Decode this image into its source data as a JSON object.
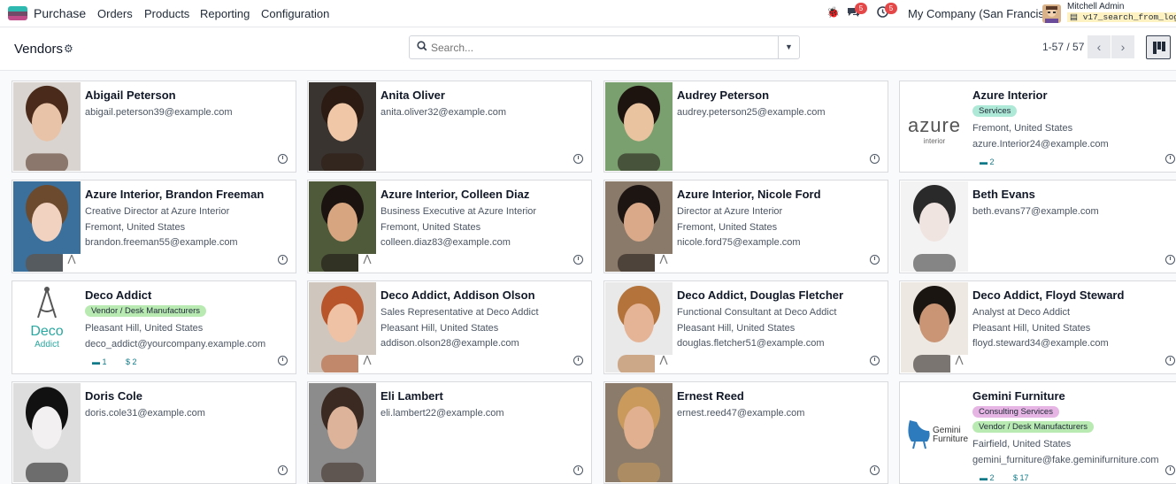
{
  "app": {
    "name": "Purchase",
    "menus": [
      "Orders",
      "Products",
      "Reporting",
      "Configuration"
    ]
  },
  "systray": {
    "messages_count": "5",
    "activities_count": "5",
    "company": "My Company (San Francisco)",
    "user_name": "Mitchell Admin",
    "database": "v17_search_from_log"
  },
  "control_panel": {
    "title": "Vendors",
    "search_placeholder": "Search...",
    "pager": "1-57 / 57"
  },
  "icons": {
    "bug": "bug-icon",
    "chat": "chat-icon",
    "clock": "clock-icon",
    "gear": "gear-icon",
    "search": "search-icon",
    "kanban": "kanban-view-icon"
  },
  "colors": {
    "brand": "#714b67",
    "accent": "#0e7a89",
    "tag_services": "#aee8d6",
    "tag_vendor": "#b8eab2",
    "tag_consulting": "#e6b5e4"
  },
  "vendors": [
    {
      "name": "Abigail Peterson",
      "lines": [
        "abigail.peterson39@example.com"
      ],
      "tags": [],
      "stats": []
    },
    {
      "name": "Anita Oliver",
      "lines": [
        "anita.oliver32@example.com"
      ],
      "tags": [],
      "stats": []
    },
    {
      "name": "Audrey Peterson",
      "lines": [
        "audrey.peterson25@example.com"
      ],
      "tags": [],
      "stats": []
    },
    {
      "name": "Azure Interior",
      "lines": [
        "Fremont, United States",
        "azure.Interior24@example.com"
      ],
      "tags": [
        "Services"
      ],
      "stats": [
        "2"
      ],
      "logo": "azure"
    },
    {
      "name": "Azure Interior, Brandon Freeman",
      "lines": [
        "Creative Director at Azure Interior",
        "Fremont, United States",
        "brandon.freeman55@example.com"
      ],
      "tags": [],
      "stats": []
    },
    {
      "name": "Azure Interior, Colleen Diaz",
      "lines": [
        "Business Executive at Azure Interior",
        "Fremont, United States",
        "colleen.diaz83@example.com"
      ],
      "tags": [],
      "stats": []
    },
    {
      "name": "Azure Interior, Nicole Ford",
      "lines": [
        "Director at Azure Interior",
        "Fremont, United States",
        "nicole.ford75@example.com"
      ],
      "tags": [],
      "stats": []
    },
    {
      "name": "Beth Evans",
      "lines": [
        "beth.evans77@example.com"
      ],
      "tags": [],
      "stats": []
    },
    {
      "name": "Deco Addict",
      "lines": [
        "Pleasant Hill, United States",
        "deco_addict@yourcompany.example.com"
      ],
      "tags": [
        "Vendor / Desk Manufacturers"
      ],
      "stats": [
        "1",
        "$ 2"
      ],
      "logo": "deco"
    },
    {
      "name": "Deco Addict, Addison Olson",
      "lines": [
        "Sales Representative at Deco Addict",
        "Pleasant Hill, United States",
        "addison.olson28@example.com"
      ],
      "tags": [],
      "stats": []
    },
    {
      "name": "Deco Addict, Douglas Fletcher",
      "lines": [
        "Functional Consultant at Deco Addict",
        "Pleasant Hill, United States",
        "douglas.fletcher51@example.com"
      ],
      "tags": [],
      "stats": []
    },
    {
      "name": "Deco Addict, Floyd Steward",
      "lines": [
        "Analyst at Deco Addict",
        "Pleasant Hill, United States",
        "floyd.steward34@example.com"
      ],
      "tags": [],
      "stats": []
    },
    {
      "name": "Doris Cole",
      "lines": [
        "doris.cole31@example.com"
      ],
      "tags": [],
      "stats": []
    },
    {
      "name": "Eli Lambert",
      "lines": [
        "eli.lambert22@example.com"
      ],
      "tags": [],
      "stats": []
    },
    {
      "name": "Ernest Reed",
      "lines": [
        "ernest.reed47@example.com"
      ],
      "tags": [],
      "stats": []
    },
    {
      "name": "Gemini Furniture",
      "lines": [
        "Fairfield, United States",
        "gemini_furniture@fake.geminifurniture.com"
      ],
      "tags": [
        "Consulting Services",
        "Vendor / Desk Manufacturers"
      ],
      "stats": [
        "2",
        "$ 17"
      ],
      "logo": "gemini"
    }
  ],
  "logos": {
    "azure": "azure",
    "azure_sub": "interior",
    "deco": "Deco",
    "deco_sub": "Addict",
    "gemini": "Gemini",
    "gemini_sub": "Furniture"
  }
}
